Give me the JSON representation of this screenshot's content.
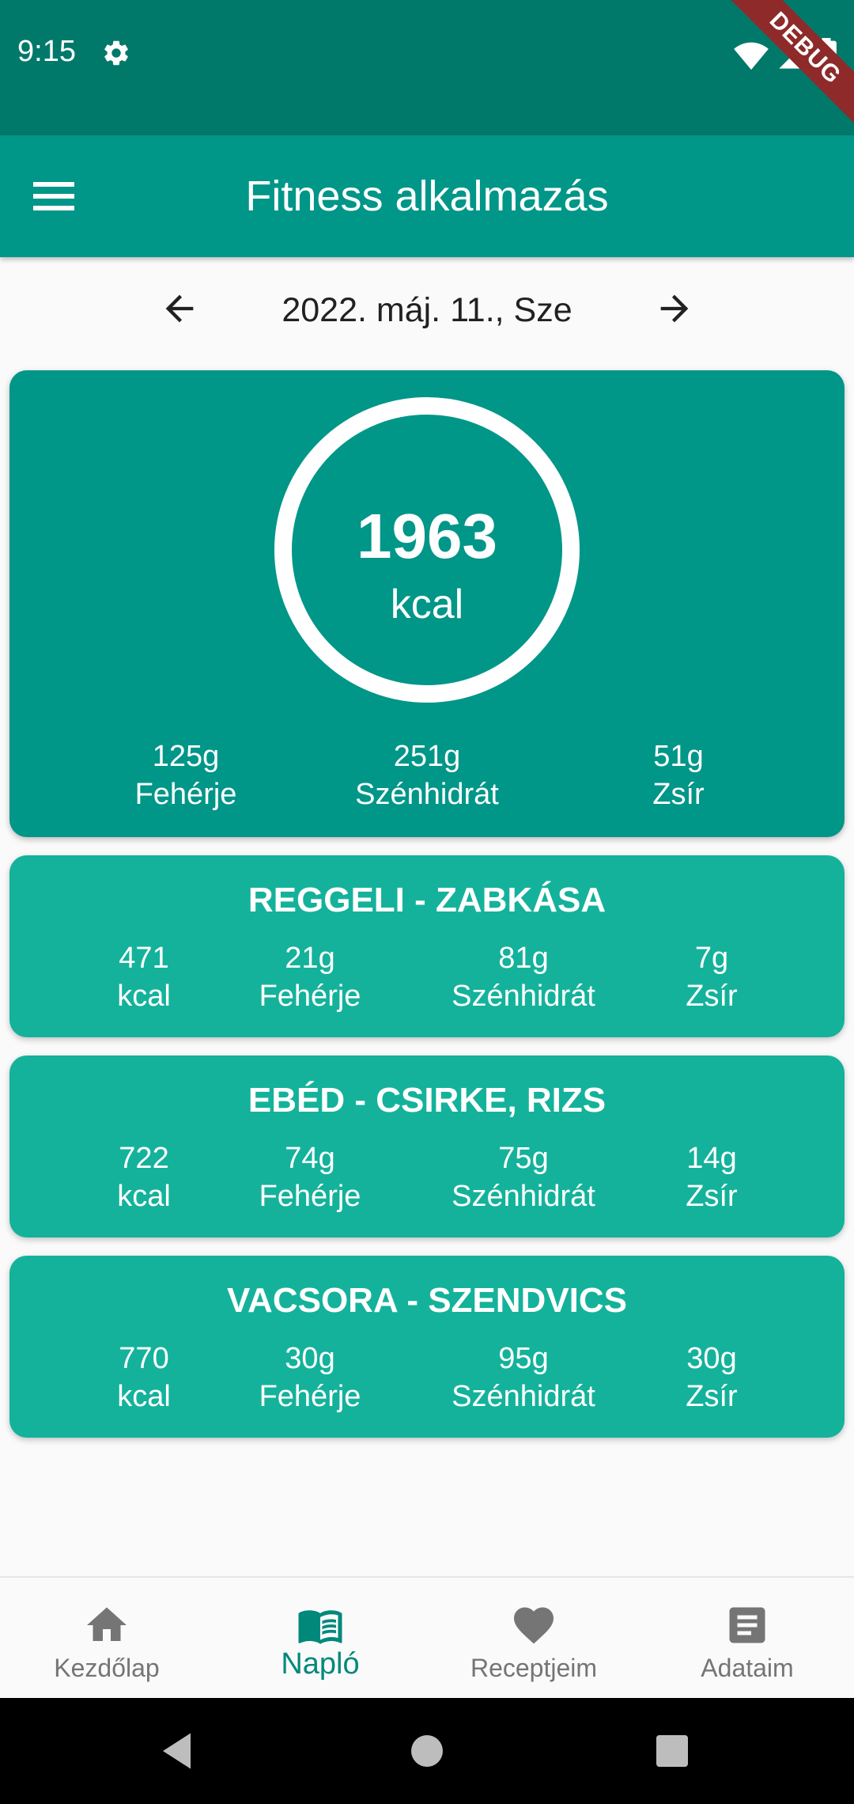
{
  "status_bar": {
    "time": "9:15",
    "debug": "DEBUG"
  },
  "app_bar": {
    "title": "Fitness alkalmazás"
  },
  "date_nav": {
    "date": "2022. máj. 11., Sze"
  },
  "summary": {
    "kcal": "1963",
    "kcal_unit": "kcal",
    "macros": [
      {
        "value": "125g",
        "label": "Fehérje"
      },
      {
        "value": "251g",
        "label": "Szénhidrát"
      },
      {
        "value": "51g",
        "label": "Zsír"
      }
    ]
  },
  "meals": [
    {
      "title": "REGGELI - ZABKÁSA",
      "kcal": "471",
      "kcal_label": "kcal",
      "protein": "21g",
      "protein_label": "Fehérje",
      "carbs": "81g",
      "carbs_label": "Szénhidrát",
      "fat": "7g",
      "fat_label": "Zsír"
    },
    {
      "title": "EBÉD - CSIRKE, RIZS",
      "kcal": "722",
      "kcal_label": "kcal",
      "protein": "74g",
      "protein_label": "Fehérje",
      "carbs": "75g",
      "carbs_label": "Szénhidrát",
      "fat": "14g",
      "fat_label": "Zsír"
    },
    {
      "title": "VACSORA - SZENDVICS",
      "kcal": "770",
      "kcal_label": "kcal",
      "protein": "30g",
      "protein_label": "Fehérje",
      "carbs": "95g",
      "carbs_label": "Szénhidrát",
      "fat": "30g",
      "fat_label": "Zsír"
    }
  ],
  "bottom_nav": {
    "items": [
      {
        "label": "Kezdőlap",
        "icon": "home-icon"
      },
      {
        "label": "Napló",
        "icon": "book-icon",
        "active": true
      },
      {
        "label": "Receptjeim",
        "icon": "heart-icon"
      },
      {
        "label": "Adataim",
        "icon": "document-icon"
      }
    ]
  },
  "colors": {
    "status_bar": "#00796b",
    "primary": "#009688",
    "meal_card": "#14b29b",
    "active_nav": "#00897b",
    "inactive_nav": "#757575"
  }
}
